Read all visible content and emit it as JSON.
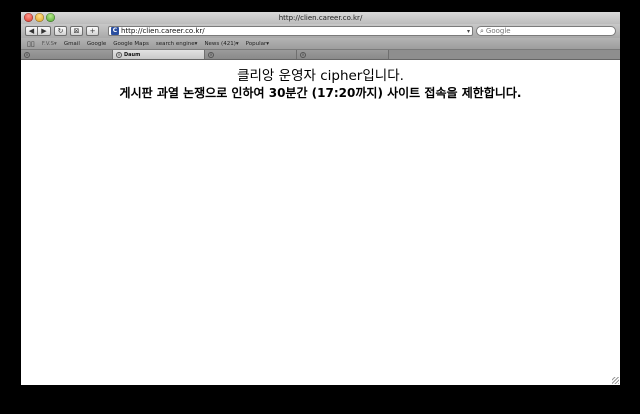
{
  "window": {
    "title": "http://clien.career.co.kr/"
  },
  "toolbar": {
    "back_icon": "◀",
    "forward_icon": "▶",
    "reload_icon": "↻",
    "snapback_icon": "⊠",
    "add_icon": "+",
    "favicon_letter": "C",
    "address_value": "http://clien.career.co.kr/",
    "search_placeholder": "Google"
  },
  "bookmarks": {
    "items": [
      {
        "label": "Google"
      },
      {
        "label": "Google Maps"
      },
      {
        "label": "News (421)▾"
      },
      {
        "label": "Popular▾"
      }
    ],
    "faded_items": [
      {
        "label": "F.V.S▾"
      },
      {
        "label": "Gmail"
      },
      {
        "label": "search engine▾"
      }
    ]
  },
  "tabs": [
    {
      "label": "Daum",
      "active": true
    }
  ],
  "content": {
    "line1": "클리앙 운영자 cipher입니다.",
    "line2": "게시판 과열 논쟁으로 인하여 30분간 (17:20까지) 사이트 접속을 제한합니다."
  }
}
